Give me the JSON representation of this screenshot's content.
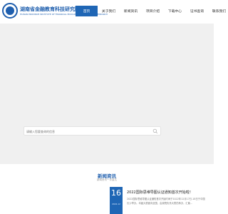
{
  "header": {
    "brand_name": "湖南省金融教育科技研究院",
    "brand_sub": "HUNAN PROVINCE INSTITUTE OF FINANCIAL EDUCATION TECHNOLOGY RESEARCH",
    "nav": [
      {
        "label": "首页",
        "active": true
      },
      {
        "label": "关于我们",
        "active": false
      },
      {
        "label": "新闻资讯",
        "active": false
      },
      {
        "label": "项目介绍",
        "active": false
      },
      {
        "label": "下载中心",
        "active": false
      },
      {
        "label": "证书查询",
        "active": false
      },
      {
        "label": "联系我们",
        "active": false
      }
    ]
  },
  "search": {
    "placeholder": "请输入您要查询的信息",
    "icon": "search-icon"
  },
  "news_section": {
    "title": "新闻资讯",
    "subtitle": "新闻资讯一手直达",
    "item": {
      "day": "16",
      "month": "2022-12",
      "title": "2022国际思维导图认证通知首次开始啦！",
      "body": "2022国际思维导图认证通知首次开始时间于2022年12月17日-18日于中国长沙举办。本届大赛面向全国，由我院负责大赛的承办，汇聚..."
    }
  },
  "colors": {
    "brand": "#1f5fae",
    "nav_active": "#1f66b5",
    "hero_bg": "#f0f0f0"
  }
}
